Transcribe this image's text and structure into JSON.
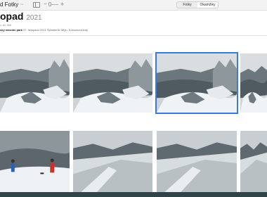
{
  "toolbar": {
    "app_name": "d Fotky",
    "app_name_suffix": " ~",
    "zoom_minus": "−",
    "zoom_plus": "+",
    "tabs": [
      {
        "label": "Fotky",
        "active": false
      },
      {
        "label": "Okamžiky",
        "active": true
      }
    ]
  },
  "header": {
    "title": "opad",
    "year": "2021",
    "subtitle": "v, 62 360",
    "place": "ský národní park",
    "date": "27. listopadu 2021",
    "details": "Špindlerův Mlýn, Kotoučsvorkotý"
  },
  "photos": [
    {
      "scene": "snowy-ridge",
      "selected": false
    },
    {
      "scene": "snowy-ridge",
      "selected": false
    },
    {
      "scene": "snowy-ridge",
      "selected": true
    },
    {
      "scene": "snowy-ridge",
      "selected": false
    },
    {
      "scene": "hikers-snow",
      "selected": false
    },
    {
      "scene": "snowy-valley",
      "selected": false
    },
    {
      "scene": "snowy-valley",
      "selected": false
    },
    {
      "scene": "snowy-valley",
      "selected": false
    }
  ],
  "colors": {
    "accent": "#3a7bd5",
    "bottom_bar": "#2f4549"
  }
}
